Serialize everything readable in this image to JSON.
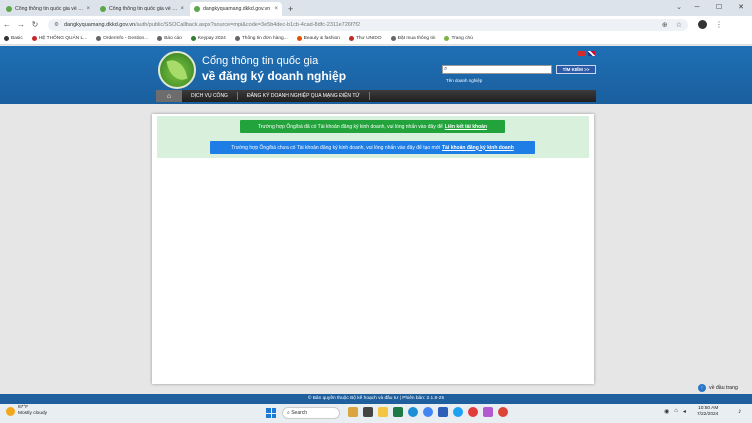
{
  "browser": {
    "tabs": [
      {
        "title": "Cổng thông tin quốc gia về đă",
        "active": false
      },
      {
        "title": "Cổng thông tin quốc gia về đă",
        "active": false
      },
      {
        "title": "dangkyquamang.dkkd.gov.vn",
        "active": true
      }
    ],
    "url_host": "dangkyquamang.dkkd.gov.vn",
    "url_path": "/auth/public/SSOCallback.aspx?source=mpi&code=3e5b4dec-b1cb-4cad-8dfc-2311e726f7f2",
    "bookmarks": [
      {
        "label": "Basic",
        "color": "#333333"
      },
      {
        "label": "HỆ THỐNG QUẢN L...",
        "color": "#c62828"
      },
      {
        "label": "OrderInfo - Gestion...",
        "color": "#555555"
      },
      {
        "label": "Báo cáo",
        "color": "#555555"
      },
      {
        "label": "Keypay 2024",
        "color": "#2e7d32"
      },
      {
        "label": "Thông tin đơn hàng...",
        "color": "#555555"
      },
      {
        "label": "Beauty & fashion",
        "color": "#e65100"
      },
      {
        "label": "Thư UNIDO",
        "color": "#c62828"
      },
      {
        "label": "Đặt mua thông tin",
        "color": "#555555"
      },
      {
        "label": "Trang chủ",
        "color": "#7cb342"
      }
    ]
  },
  "site": {
    "title_line1": "Cổng thông tin quốc gia",
    "title_line2": "về đăng ký doanh nghiệp",
    "search_button": "TÌM KIẾM >>",
    "search_caption": "Tên doanh nghiệp",
    "nav_items": [
      "DỊCH VỤ CÔNG",
      "ĐĂNG KÝ DOANH NGHIỆP QUA MẠNG ĐIỆN TỬ"
    ]
  },
  "main": {
    "green_text": "Trường hợp Ông/bà đã có Tài khoản đăng ký kinh doanh, vui lòng nhấn vào đây để",
    "green_link": "Liên kết tài khoản",
    "blue_text": "Trường hợp Ông/bà chưa có Tài khoản đăng ký kinh doanh, vui lòng nhấn vào đây để tạo mới",
    "blue_link": "Tài khoản đăng ký kinh doanh",
    "help_label": "về đầu trang"
  },
  "footer": {
    "text": "© Bản quyền thuộc Bộ kế hoạch và đầu tư | Phiên bản: 2.1.8-25"
  },
  "taskbar": {
    "temperature": "87°F",
    "weather": "Mostly cloudy",
    "search_placeholder": "Search",
    "time": "10:50 AM",
    "date": "7/22/2024"
  }
}
